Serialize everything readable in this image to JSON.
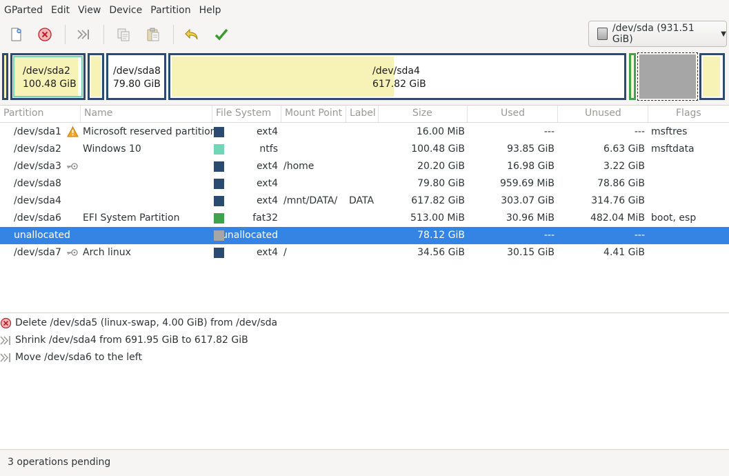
{
  "menu": [
    "GParted",
    "Edit",
    "View",
    "Device",
    "Partition",
    "Help"
  ],
  "toolbar": {
    "icons": [
      "new-icon",
      "delete-icon",
      "resize-move-icon",
      "copy-icon",
      "paste-icon",
      "undo-icon",
      "apply-icon"
    ],
    "device_selector": "/dev/sda (931.51 GiB)"
  },
  "diskmap": {
    "sda2": {
      "name": "/dev/sda2",
      "size": "100.48 GiB"
    },
    "sda8": {
      "name": "/dev/sda8",
      "size": "79.80 GiB"
    },
    "sda4": {
      "name": "/dev/sda4",
      "size": "617.82 GiB"
    }
  },
  "columns": [
    "Partition",
    "Name",
    "File System",
    "Mount Point",
    "Label",
    "Size",
    "Used",
    "Unused",
    "Flags"
  ],
  "partitions": [
    {
      "partition": "/dev/sda1",
      "icon": "warning-icon",
      "name": "Microsoft reserved partition",
      "filesystem": "ext4",
      "fs_color": "#2b4a70",
      "mount": "",
      "label": "",
      "size": "16.00 MiB",
      "used": "---",
      "unused": "---",
      "flags": "msftres"
    },
    {
      "partition": "/dev/sda2",
      "icon": "",
      "name": "Windows 10",
      "filesystem": "ntfs",
      "fs_color": "#72d6b6",
      "mount": "",
      "label": "",
      "size": "100.48 GiB",
      "used": "93.85 GiB",
      "unused": "6.63 GiB",
      "flags": "msftdata"
    },
    {
      "partition": "/dev/sda3",
      "icon": "key-icon",
      "name": "",
      "filesystem": "ext4",
      "fs_color": "#2b4a70",
      "mount": "/home",
      "label": "",
      "size": "20.20 GiB",
      "used": "16.98 GiB",
      "unused": "3.22 GiB",
      "flags": ""
    },
    {
      "partition": "/dev/sda8",
      "icon": "",
      "name": "",
      "filesystem": "ext4",
      "fs_color": "#2b4a70",
      "mount": "",
      "label": "",
      "size": "79.80 GiB",
      "used": "959.69 MiB",
      "unused": "78.86 GiB",
      "flags": ""
    },
    {
      "partition": "/dev/sda4",
      "icon": "",
      "name": "",
      "filesystem": "ext4",
      "fs_color": "#2b4a70",
      "mount": "/mnt/DATA/",
      "label": "DATA",
      "size": "617.82 GiB",
      "used": "303.07 GiB",
      "unused": "314.76 GiB",
      "flags": ""
    },
    {
      "partition": "/dev/sda6",
      "icon": "",
      "name": "EFI System Partition",
      "filesystem": "fat32",
      "fs_color": "#3fa34d",
      "mount": "",
      "label": "",
      "size": "513.00 MiB",
      "used": "30.96 MiB",
      "unused": "482.04 MiB",
      "flags": "boot, esp"
    },
    {
      "partition": "unallocated",
      "icon": "",
      "name": "",
      "filesystem": "unallocated",
      "fs_color": "#a6a6a6",
      "mount": "",
      "label": "",
      "size": "78.12 GiB",
      "used": "---",
      "unused": "---",
      "flags": "",
      "selected": true
    },
    {
      "partition": "/dev/sda7",
      "icon": "key-icon",
      "name": "Arch linux",
      "filesystem": "ext4",
      "fs_color": "#2b4a70",
      "mount": "/",
      "label": "",
      "size": "34.56 GiB",
      "used": "30.15 GiB",
      "unused": "4.41 GiB",
      "flags": ""
    }
  ],
  "operations": [
    {
      "icon": "delete-icon",
      "text": "Delete /dev/sda5 (linux-swap, 4.00 GiB) from /dev/sda"
    },
    {
      "icon": "resize-move-icon",
      "text": "Shrink /dev/sda4 from 691.95 GiB to 617.82 GiB"
    },
    {
      "icon": "resize-move-icon",
      "text": "Move /dev/sda6 to the left"
    }
  ],
  "status": "3 operations pending"
}
